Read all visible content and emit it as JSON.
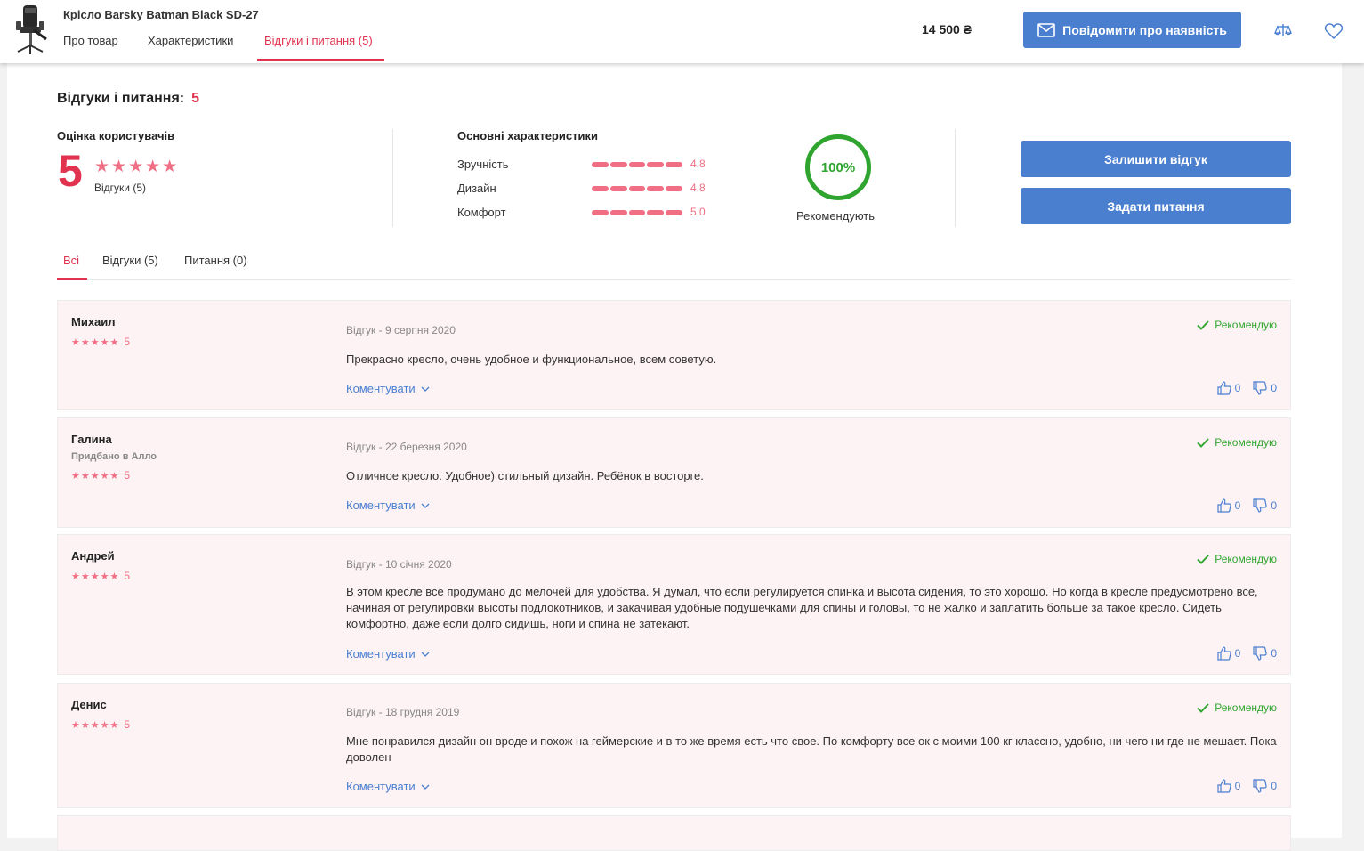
{
  "header": {
    "product_title": "Крісло Barsky Batman Black SD-27",
    "tabs": [
      {
        "label": "Про товар"
      },
      {
        "label": "Характеристики"
      },
      {
        "label": "Відгуки і питання (5)"
      }
    ],
    "price": "14 500 ₴",
    "notify_label": "Повідомити про наявність",
    "accent_color": "#e1324f",
    "button_color": "#4a7fd0"
  },
  "reviews_section": {
    "title": "Відгуки і питання:",
    "count": "5",
    "user_rating_label": "Оцінка користувачів",
    "score": "5",
    "stars": "★★★★★",
    "reviews_link": "Відгуки (5)",
    "characteristics_title": "Основні характеристики",
    "characteristics": [
      {
        "name": "Зручність",
        "value": "4.8"
      },
      {
        "name": "Дизайн",
        "value": "4.8"
      },
      {
        "name": "Комфорт",
        "value": "5.0"
      }
    ],
    "recommend_percent": "100%",
    "recommend_label": "Рекомендують",
    "leave_review_label": "Залишити відгук",
    "ask_question_label": "Задати питання",
    "filter_tabs": [
      {
        "label": "Всі"
      },
      {
        "label": "Відгуки (5)"
      },
      {
        "label": "Питання (0)"
      }
    ]
  },
  "reviews": [
    {
      "author": "Михаил",
      "bought": "",
      "stars": "★★★★★",
      "rating": "5",
      "meta": "Відгук - 9 серпня 2020",
      "text": "Прекрасно кресло, очень удобное и функциональное, всем советую.",
      "recommend": "Рекомендую",
      "comment": "Коментувати",
      "likes": "0",
      "dislikes": "0"
    },
    {
      "author": "Галина",
      "bought": "Придбано в Алло",
      "stars": "★★★★★",
      "rating": "5",
      "meta": "Відгук - 22 березня 2020",
      "text": "Отличное кресло. Удобное) стильный дизайн. Ребёнок в восторге.",
      "recommend": "Рекомендую",
      "comment": "Коментувати",
      "likes": "0",
      "dislikes": "0"
    },
    {
      "author": "Андрей",
      "bought": "",
      "stars": "★★★★★",
      "rating": "5",
      "meta": "Відгук - 10 січня 2020",
      "text": "В этом кресле все продумано до мелочей для удобства. Я думал, что если регулируется спинка и высота сидения, то это хорошо. Но когда в кресле предусмотрено все, начиная от регулировки высоты подлокотников, и закачивая удобные подушечками для спины и головы, то не жалко и заплатить больше за такое кресло. Сидеть комфортно, даже если долго сидишь, ноги и спина не затекают.",
      "recommend": "Рекомендую",
      "comment": "Коментувати",
      "likes": "0",
      "dislikes": "0"
    },
    {
      "author": "Денис",
      "bought": "",
      "stars": "★★★★★",
      "rating": "5",
      "meta": "Відгук - 18 грудня 2019",
      "text": "Мне понравился дизайн он вроде и похож на геймерские и в то же время есть что свое. По комфорту все ок с моими 100 кг классно, удобно, ни чего ни где не мешает. Пока доволен",
      "recommend": "Рекомендую",
      "comment": "Коментувати",
      "likes": "0",
      "dislikes": "0"
    }
  ]
}
